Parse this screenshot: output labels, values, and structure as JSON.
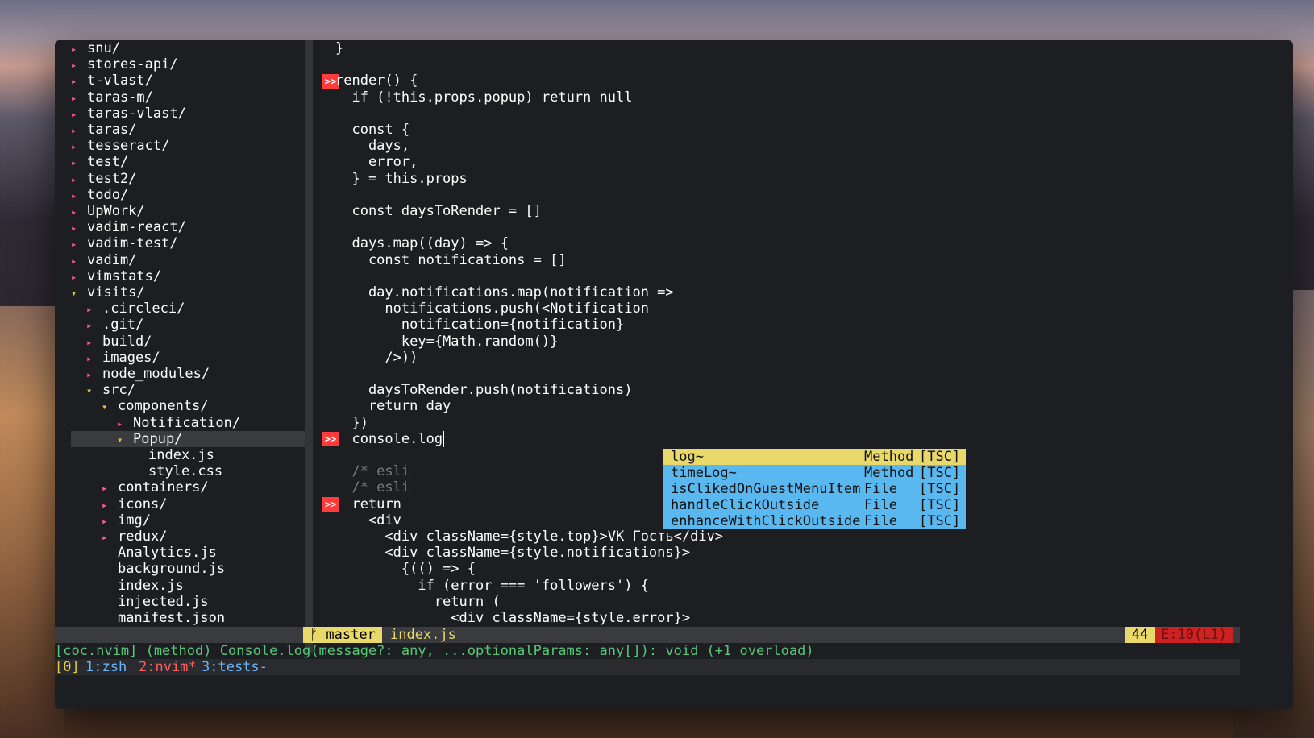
{
  "tree": {
    "rows": [
      {
        "arrow": "▸",
        "label": "snu/"
      },
      {
        "arrow": "▸",
        "label": "stores-api/"
      },
      {
        "arrow": "▸",
        "label": "t-vlast/"
      },
      {
        "arrow": "▸",
        "label": "taras-m/"
      },
      {
        "arrow": "▸",
        "label": "taras-vlast/"
      },
      {
        "arrow": "▸",
        "label": "taras/"
      },
      {
        "arrow": "▸",
        "label": "tesseract/"
      },
      {
        "arrow": "▸",
        "label": "test/"
      },
      {
        "arrow": "▸",
        "label": "test2/"
      },
      {
        "arrow": "▸",
        "label": "todo/"
      },
      {
        "arrow": "▸",
        "label": "UpWork/"
      },
      {
        "arrow": "▸",
        "label": "vadim-react/"
      },
      {
        "arrow": "▸",
        "label": "vadim-test/"
      },
      {
        "arrow": "▸",
        "label": "vadim/"
      },
      {
        "arrow": "▸",
        "label": "vimstats/"
      },
      {
        "arrow": "▾",
        "label": "visits/"
      },
      {
        "arrow": "▸",
        "label": ".circleci/"
      },
      {
        "arrow": "▸",
        "label": ".git/"
      },
      {
        "arrow": "▸",
        "label": "build/"
      },
      {
        "arrow": "▸",
        "label": "images/"
      },
      {
        "arrow": "▸",
        "label": "node_modules/"
      },
      {
        "arrow": "▾",
        "label": "src/"
      },
      {
        "arrow": "▾",
        "label": "components/"
      },
      {
        "arrow": "▸",
        "label": "Notification/"
      },
      {
        "arrow": "▾",
        "label": "Popup/"
      },
      {
        "arrow": "",
        "label": "index.js"
      },
      {
        "arrow": "",
        "label": "style.css"
      },
      {
        "arrow": "▸",
        "label": "containers/"
      },
      {
        "arrow": "▸",
        "label": "icons/"
      },
      {
        "arrow": "▸",
        "label": "img/"
      },
      {
        "arrow": "▸",
        "label": "redux/"
      },
      {
        "arrow": "",
        "label": "Analytics.js"
      },
      {
        "arrow": "",
        "label": "background.js"
      },
      {
        "arrow": "",
        "label": "index.js"
      },
      {
        "arrow": "",
        "label": "injected.js"
      },
      {
        "arrow": "",
        "label": "manifest.json"
      }
    ]
  },
  "editor": {
    "sign_glyph": ">>",
    "lines": [
      "}",
      "",
      "render() {",
      "  if (!this.props.popup) return null",
      "",
      "  const {",
      "    days,",
      "    error,",
      "  } = this.props",
      "",
      "  const daysToRender = []",
      "",
      "  days.map((day) => {",
      "    const notifications = []",
      "",
      "    day.notifications.map(notification =>",
      "      notifications.push(<Notification",
      "        notification={notification}",
      "        key={Math.random()}",
      "      />))",
      "",
      "    daysToRender.push(notifications)",
      "    return day",
      "  })",
      "  console.log",
      "",
      "  /* esli                                  nteractions */",
      "  /* esli                                  ey-events */",
      "  return",
      "    <div",
      "      <div className={style.top}>VK Гость</div>",
      "      <div className={style.notifications}>",
      "        {(() => {",
      "          if (error === 'followers') {",
      "            return (",
      "              <div className={style.error}>"
    ]
  },
  "completion": {
    "items": [
      {
        "word": "log~",
        "kind": "Method",
        "source": "[TSC]"
      },
      {
        "word": "timeLog~",
        "kind": "Method",
        "source": "[TSC]"
      },
      {
        "word": "isClikedOnGuestMenuItem",
        "kind": "File",
        "source": "[TSC]"
      },
      {
        "word": "handleClickOutside",
        "kind": "File",
        "source": "[TSC]"
      },
      {
        "word": "enhanceWithClickOutside",
        "kind": "File",
        "source": "[TSC]"
      }
    ]
  },
  "statusline": {
    "branch": "ᚠ master",
    "file": "index.js",
    "line": "44",
    "errors": "E:10(L1)"
  },
  "cmdline": {
    "text": "[coc.nvim] (method) Console.log(message?: any, ...optionalParams: any[]): void (+1 overload)"
  },
  "tmux": {
    "session": "[0]",
    "window1": "1:zsh",
    "window2": "2:nvim*",
    "window3": "3:tests-"
  }
}
